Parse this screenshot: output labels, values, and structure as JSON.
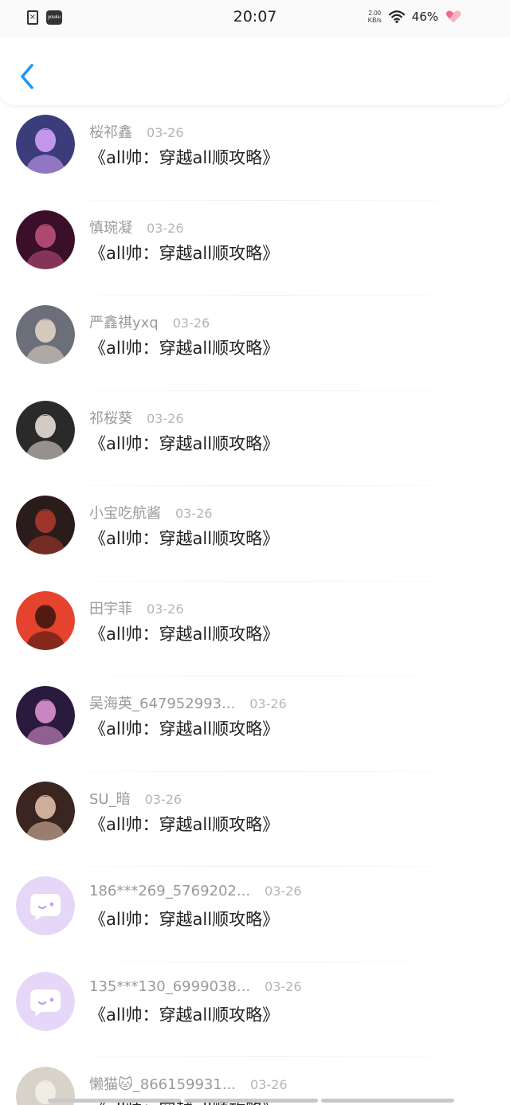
{
  "status_bar": {
    "time": "20:07",
    "net_speed_value": "2.00",
    "net_speed_unit": "KB/s",
    "battery": "46%",
    "app_badge": "youku"
  },
  "header": {
    "back_icon": "chevron-left-icon",
    "accent_color": "#2196f3"
  },
  "comments": [
    {
      "username": "桜祁鑫",
      "date": "03-26",
      "text": "《all帅：穿越all顺攻略》",
      "avatar_color": "#3a3d7a",
      "avatar_accent": "#d9a7ff"
    },
    {
      "username": "慎琬凝",
      "date": "03-26",
      "text": "《all帅：穿越all顺攻略》",
      "avatar_color": "#3b0e2a",
      "avatar_accent": "#c2537c"
    },
    {
      "username": "严鑫祺yxq",
      "date": "03-26",
      "text": "《all帅：穿越all顺攻略》",
      "avatar_color": "#6a6f7a",
      "avatar_accent": "#e8d8c8"
    },
    {
      "username": "祁桜葵",
      "date": "03-26",
      "text": "《all帅：穿越all顺攻略》",
      "avatar_color": "#2a2a2a",
      "avatar_accent": "#efe6e0"
    },
    {
      "username": "小宝吃航酱",
      "date": "03-26",
      "text": "《all帅：穿越all顺攻略》",
      "avatar_color": "#2b1c1c",
      "avatar_accent": "#b23a2e"
    },
    {
      "username": "田宇菲",
      "date": "03-26",
      "text": "《all帅：穿越all顺攻略》",
      "avatar_color": "#e5432d",
      "avatar_accent": "#3a130e"
    },
    {
      "username": "吴海英_647952993...",
      "date": "03-26",
      "text": "《all帅：穿越all顺攻略》",
      "avatar_color": "#2a1a3d",
      "avatar_accent": "#e59ad8"
    },
    {
      "username": "SU_暗",
      "date": "03-26",
      "text": "《all帅：穿越all顺攻略》",
      "avatar_color": "#3a2520",
      "avatar_accent": "#e8c7b0"
    },
    {
      "username": "186***269_5769202...",
      "date": "03-26",
      "text": "《all帅：穿越all顺攻略》",
      "avatar_color": "#e6d6f7",
      "avatar_accent": "#c4a3ee",
      "default_avatar": true
    },
    {
      "username": "135***130_6999038...",
      "date": "03-26",
      "text": "《all帅：穿越all顺攻略》",
      "avatar_color": "#e6d6f7",
      "avatar_accent": "#c4a3ee",
      "default_avatar": true
    },
    {
      "username": "懒猫🐱_866159931...",
      "date": "03-26",
      "text": "《all帅：穿越all顺攻略》",
      "avatar_color": "#d8d2c8",
      "avatar_accent": "#f5f2ec"
    }
  ]
}
